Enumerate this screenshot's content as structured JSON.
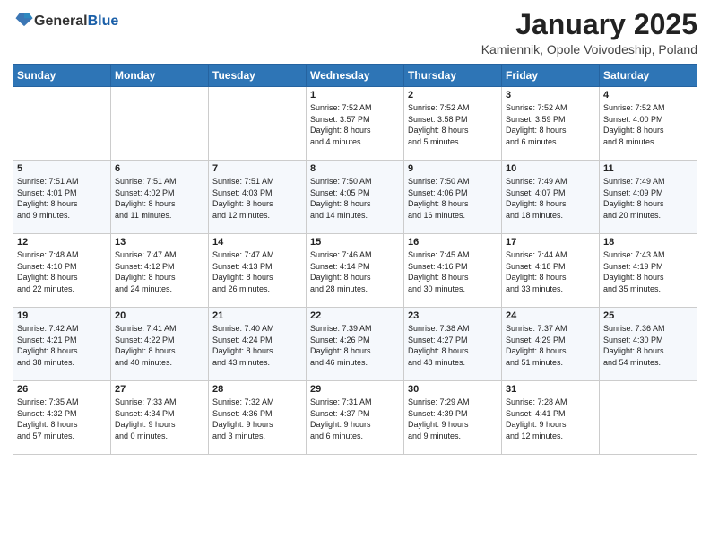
{
  "header": {
    "logo_general": "General",
    "logo_blue": "Blue",
    "month_title": "January 2025",
    "subtitle": "Kamiennik, Opole Voivodeship, Poland"
  },
  "weekdays": [
    "Sunday",
    "Monday",
    "Tuesday",
    "Wednesday",
    "Thursday",
    "Friday",
    "Saturday"
  ],
  "weeks": [
    [
      {
        "day": "",
        "info": ""
      },
      {
        "day": "",
        "info": ""
      },
      {
        "day": "",
        "info": ""
      },
      {
        "day": "1",
        "info": "Sunrise: 7:52 AM\nSunset: 3:57 PM\nDaylight: 8 hours\nand 4 minutes."
      },
      {
        "day": "2",
        "info": "Sunrise: 7:52 AM\nSunset: 3:58 PM\nDaylight: 8 hours\nand 5 minutes."
      },
      {
        "day": "3",
        "info": "Sunrise: 7:52 AM\nSunset: 3:59 PM\nDaylight: 8 hours\nand 6 minutes."
      },
      {
        "day": "4",
        "info": "Sunrise: 7:52 AM\nSunset: 4:00 PM\nDaylight: 8 hours\nand 8 minutes."
      }
    ],
    [
      {
        "day": "5",
        "info": "Sunrise: 7:51 AM\nSunset: 4:01 PM\nDaylight: 8 hours\nand 9 minutes."
      },
      {
        "day": "6",
        "info": "Sunrise: 7:51 AM\nSunset: 4:02 PM\nDaylight: 8 hours\nand 11 minutes."
      },
      {
        "day": "7",
        "info": "Sunrise: 7:51 AM\nSunset: 4:03 PM\nDaylight: 8 hours\nand 12 minutes."
      },
      {
        "day": "8",
        "info": "Sunrise: 7:50 AM\nSunset: 4:05 PM\nDaylight: 8 hours\nand 14 minutes."
      },
      {
        "day": "9",
        "info": "Sunrise: 7:50 AM\nSunset: 4:06 PM\nDaylight: 8 hours\nand 16 minutes."
      },
      {
        "day": "10",
        "info": "Sunrise: 7:49 AM\nSunset: 4:07 PM\nDaylight: 8 hours\nand 18 minutes."
      },
      {
        "day": "11",
        "info": "Sunrise: 7:49 AM\nSunset: 4:09 PM\nDaylight: 8 hours\nand 20 minutes."
      }
    ],
    [
      {
        "day": "12",
        "info": "Sunrise: 7:48 AM\nSunset: 4:10 PM\nDaylight: 8 hours\nand 22 minutes."
      },
      {
        "day": "13",
        "info": "Sunrise: 7:47 AM\nSunset: 4:12 PM\nDaylight: 8 hours\nand 24 minutes."
      },
      {
        "day": "14",
        "info": "Sunrise: 7:47 AM\nSunset: 4:13 PM\nDaylight: 8 hours\nand 26 minutes."
      },
      {
        "day": "15",
        "info": "Sunrise: 7:46 AM\nSunset: 4:14 PM\nDaylight: 8 hours\nand 28 minutes."
      },
      {
        "day": "16",
        "info": "Sunrise: 7:45 AM\nSunset: 4:16 PM\nDaylight: 8 hours\nand 30 minutes."
      },
      {
        "day": "17",
        "info": "Sunrise: 7:44 AM\nSunset: 4:18 PM\nDaylight: 8 hours\nand 33 minutes."
      },
      {
        "day": "18",
        "info": "Sunrise: 7:43 AM\nSunset: 4:19 PM\nDaylight: 8 hours\nand 35 minutes."
      }
    ],
    [
      {
        "day": "19",
        "info": "Sunrise: 7:42 AM\nSunset: 4:21 PM\nDaylight: 8 hours\nand 38 minutes."
      },
      {
        "day": "20",
        "info": "Sunrise: 7:41 AM\nSunset: 4:22 PM\nDaylight: 8 hours\nand 40 minutes."
      },
      {
        "day": "21",
        "info": "Sunrise: 7:40 AM\nSunset: 4:24 PM\nDaylight: 8 hours\nand 43 minutes."
      },
      {
        "day": "22",
        "info": "Sunrise: 7:39 AM\nSunset: 4:26 PM\nDaylight: 8 hours\nand 46 minutes."
      },
      {
        "day": "23",
        "info": "Sunrise: 7:38 AM\nSunset: 4:27 PM\nDaylight: 8 hours\nand 48 minutes."
      },
      {
        "day": "24",
        "info": "Sunrise: 7:37 AM\nSunset: 4:29 PM\nDaylight: 8 hours\nand 51 minutes."
      },
      {
        "day": "25",
        "info": "Sunrise: 7:36 AM\nSunset: 4:30 PM\nDaylight: 8 hours\nand 54 minutes."
      }
    ],
    [
      {
        "day": "26",
        "info": "Sunrise: 7:35 AM\nSunset: 4:32 PM\nDaylight: 8 hours\nand 57 minutes."
      },
      {
        "day": "27",
        "info": "Sunrise: 7:33 AM\nSunset: 4:34 PM\nDaylight: 9 hours\nand 0 minutes."
      },
      {
        "day": "28",
        "info": "Sunrise: 7:32 AM\nSunset: 4:36 PM\nDaylight: 9 hours\nand 3 minutes."
      },
      {
        "day": "29",
        "info": "Sunrise: 7:31 AM\nSunset: 4:37 PM\nDaylight: 9 hours\nand 6 minutes."
      },
      {
        "day": "30",
        "info": "Sunrise: 7:29 AM\nSunset: 4:39 PM\nDaylight: 9 hours\nand 9 minutes."
      },
      {
        "day": "31",
        "info": "Sunrise: 7:28 AM\nSunset: 4:41 PM\nDaylight: 9 hours\nand 12 minutes."
      },
      {
        "day": "",
        "info": ""
      }
    ]
  ]
}
